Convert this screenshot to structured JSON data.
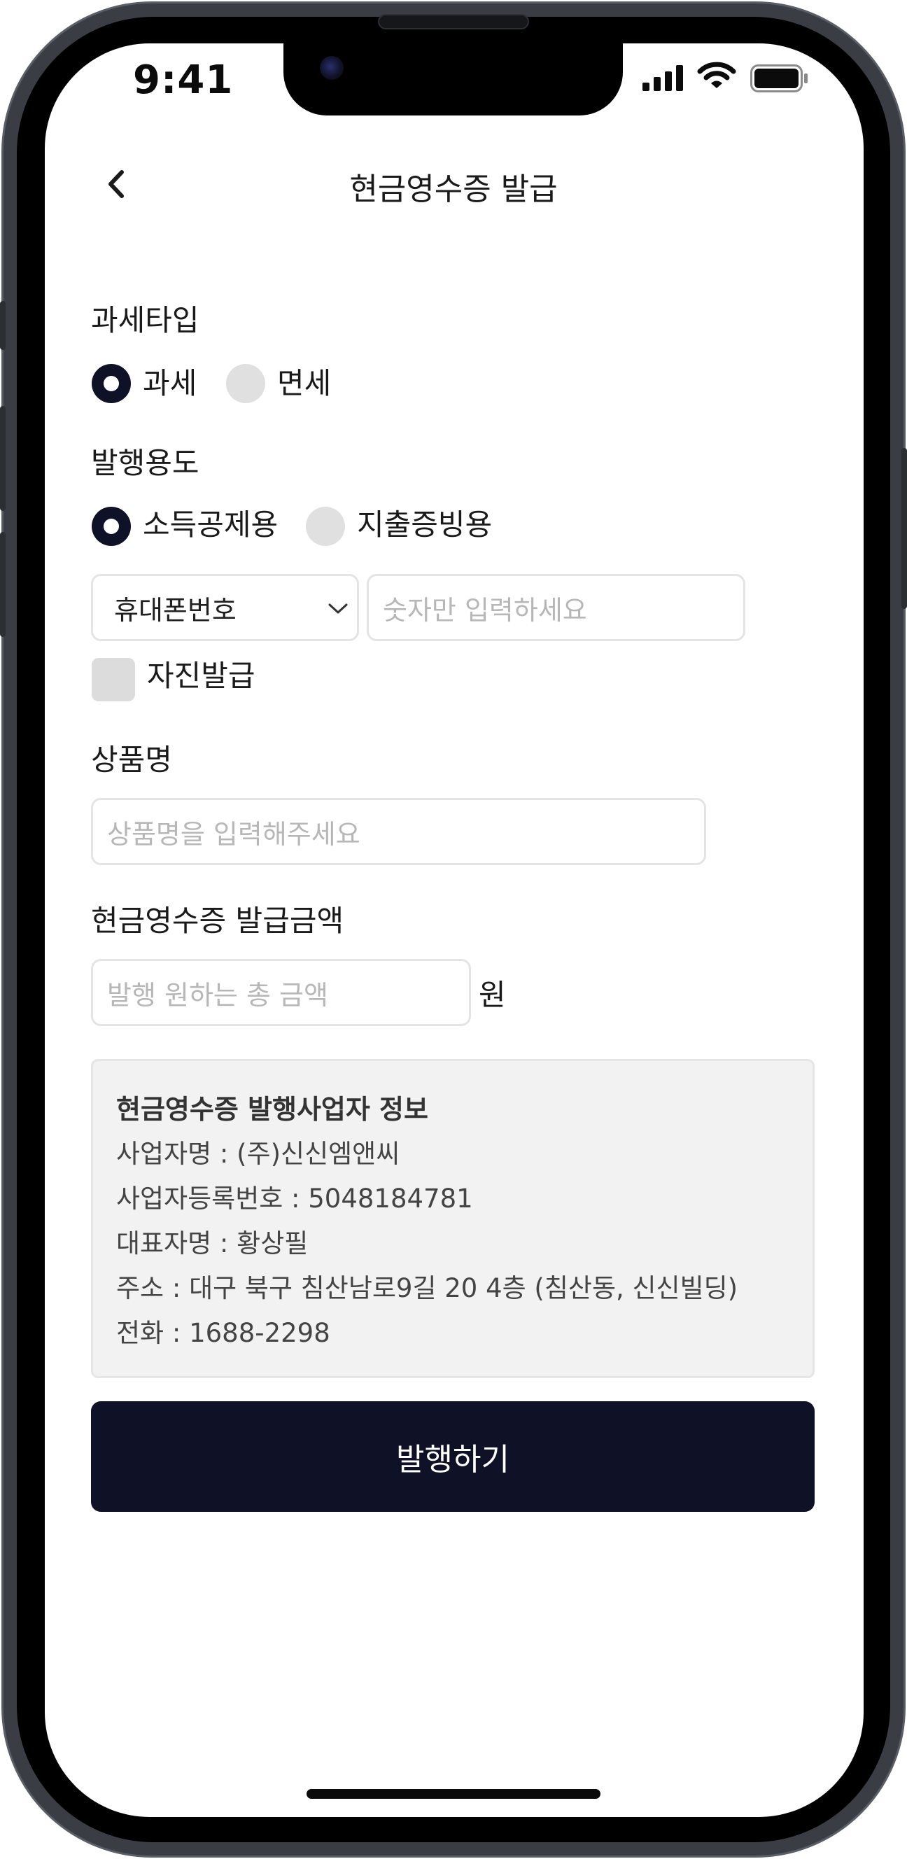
{
  "status_bar": {
    "time": "9:41"
  },
  "header": {
    "title": "현금영수증 발급"
  },
  "tax_type": {
    "label": "과세타입",
    "options": [
      {
        "label": "과세",
        "selected": true
      },
      {
        "label": "면세",
        "selected": false
      }
    ]
  },
  "purpose": {
    "label": "발행용도",
    "options": [
      {
        "label": "소득공제용",
        "selected": true
      },
      {
        "label": "지출증빙용",
        "selected": false
      }
    ]
  },
  "id_type": {
    "selected": "휴대폰번호"
  },
  "id_number": {
    "placeholder": "숫자만 입력하세요"
  },
  "self_issue": {
    "label": "자진발급",
    "checked": false
  },
  "product": {
    "label": "상품명",
    "placeholder": "상품명을 입력해주세요"
  },
  "amount": {
    "label": "현금영수증 발급금액",
    "placeholder": "발행 원하는 총 금액",
    "unit": "원"
  },
  "issuer_info": {
    "title": "현금영수증 발행사업자 정보",
    "lines": [
      "사업자명 : (주)신신엠앤씨",
      "사업자등록번호 : 5048184781",
      "대표자명 : 황상필",
      "주소 : 대구 북구 침산남로9길 20 4층 (침산동, 신신빌딩)",
      "전화 : 1688-2298"
    ]
  },
  "submit": {
    "label": "발행하기"
  },
  "colors": {
    "primary": "#0f1226",
    "radio_off": "#e0e0e0",
    "info_bg": "#f2f2f2"
  }
}
